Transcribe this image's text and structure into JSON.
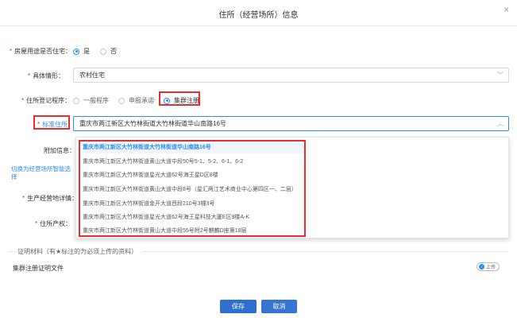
{
  "dialog": {
    "title": "住所（经营场所）信息",
    "close": "×"
  },
  "form": {
    "residential": {
      "label": "房屋用途是否住宅：",
      "options": [
        "是",
        "否"
      ],
      "selected": 0
    },
    "situation": {
      "label": "具体情形：",
      "value": "农村住宅"
    },
    "registration": {
      "label": "住所登记程序：",
      "options": [
        "一般程序",
        "申报承诺",
        "集群注册"
      ],
      "selected": 2
    },
    "standard_address": {
      "label": "标准住所：",
      "value": "重庆市两江新区大竹林街道大竹林街道华山南路16号"
    },
    "extra_info": {
      "label": "附加信息："
    },
    "switch_link": "切换为经营场所智能选择",
    "production": {
      "label": "生产经营地详情："
    },
    "property": {
      "label": "住所产权："
    }
  },
  "dropdown": {
    "options": [
      "重庆市两江新区大竹林街道大竹林街道华山南路16号",
      "重庆市两江新区大竹林街道黄山大道中段50号5-1、5-2、6-1、6-2",
      "重庆市两江新区大竹林街道星光大道62号海王星D区8楼",
      "重庆市两江新区大竹林街道黄山大道中段8号（星汇两江艺术商业中心第四区一、二层）",
      "重庆市两江新区大竹林街道金开大道西段210号3幢3号",
      "重庆市两江新区大竹林街道星光大道62号海王星科技大厦E区9楼A-K",
      "重庆市两江新区大竹林街道黄山大道中段55号附2号麒麟D座第18层"
    ]
  },
  "attachments": {
    "section_title": "证明材料（有★标注的为必须上传的资料）",
    "item_label": "集群注册证明文件",
    "upload_label": "上传"
  },
  "buttons": {
    "save": "保存",
    "cancel": "取消"
  },
  "colors": {
    "accent": "#2d8cf0",
    "required": "#e62e2e",
    "primary_button": "#2f6fcf"
  }
}
